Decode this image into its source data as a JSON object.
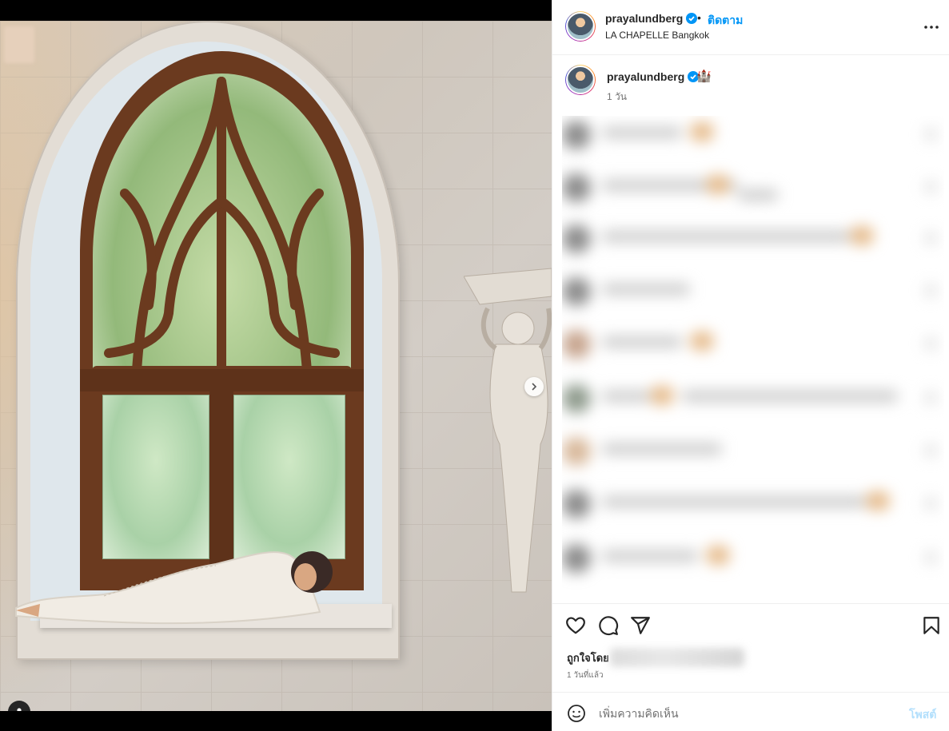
{
  "post": {
    "username": "prayalundberg",
    "follow_label": "ติดตาม",
    "bullet": "•",
    "location": "LA CHAPELLE Bangkok",
    "caption_emoji": "🏰",
    "caption_age": "1 วัน",
    "liked_by_label": "ถูกใจโดย",
    "time_ago": "1 วันที่แล้ว",
    "carousel": {
      "total_slides": 2,
      "current_slide": 1
    }
  },
  "composer": {
    "placeholder": "เพิ่มความคิดเห็น",
    "post_label": "โพสต์"
  },
  "colors": {
    "accent": "#0095f6",
    "post_disabled": "#b2dffc",
    "text": "#262626",
    "muted": "#737373",
    "divider": "#efefef"
  },
  "icons": {
    "header": [
      "verified-badge-icon",
      "more-options-icon"
    ],
    "actions": [
      "heart-icon",
      "comment-icon",
      "share-icon",
      "bookmark-icon"
    ],
    "media": [
      "chevron-right-icon",
      "user-tag-icon"
    ],
    "composer": [
      "emoji-icon"
    ]
  }
}
